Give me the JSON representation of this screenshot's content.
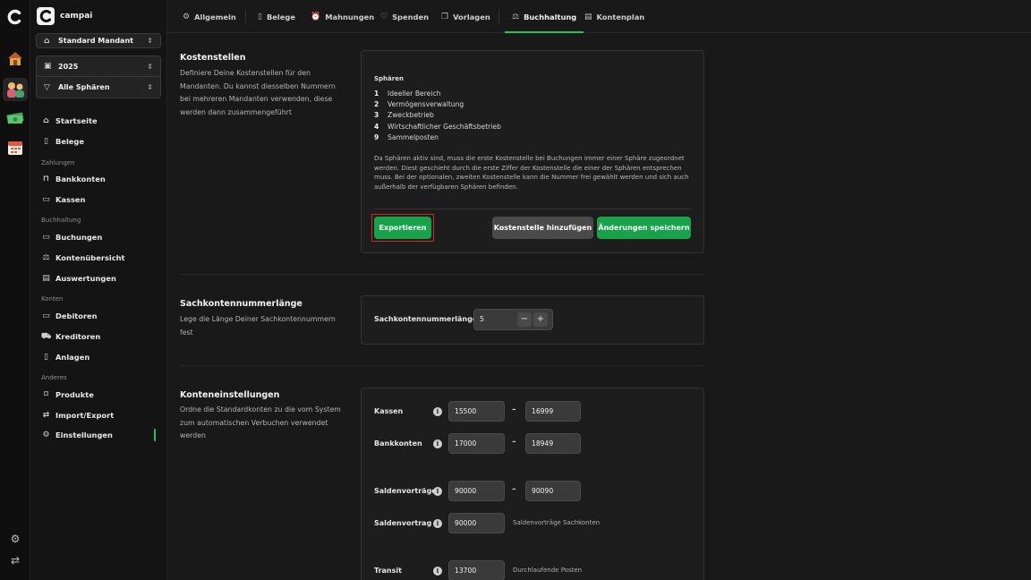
{
  "app": {
    "name": "campai",
    "tenant": "Standard Mandant",
    "year": "2025",
    "sphere_filter": "Alle Sphären"
  },
  "rail": {
    "apps": [
      "house-app-icon",
      "people-app-icon",
      "money-app-icon",
      "calendar-app-icon"
    ],
    "bottom": [
      "settings-cog-icon",
      "switch-arrows-icon"
    ]
  },
  "sidebar": {
    "items": [
      {
        "label": "Startseite",
        "icon": "home-icon"
      },
      {
        "label": "Belege",
        "icon": "document-icon"
      }
    ],
    "sections": [
      {
        "title": "Zahlungen",
        "items": [
          {
            "label": "Bankkonten",
            "icon": "bank-icon"
          },
          {
            "label": "Kassen",
            "icon": "cash-icon"
          }
        ]
      },
      {
        "title": "Buchhaltung",
        "items": [
          {
            "label": "Buchungen",
            "icon": "inbox-icon"
          },
          {
            "label": "Kontenübersicht",
            "icon": "scale-icon"
          },
          {
            "label": "Auswertungen",
            "icon": "table-icon"
          }
        ]
      },
      {
        "title": "Konten",
        "items": [
          {
            "label": "Debitoren",
            "icon": "card-icon"
          },
          {
            "label": "Kreditoren",
            "icon": "truck-icon"
          },
          {
            "label": "Anlagen",
            "icon": "book-icon"
          }
        ]
      },
      {
        "title": "Anderes",
        "items": [
          {
            "label": "Produkte",
            "icon": "bag-icon"
          },
          {
            "label": "Import/Export",
            "icon": "arrows-icon"
          },
          {
            "label": "Einstellungen",
            "icon": "gear-icon",
            "active": true
          }
        ]
      }
    ]
  },
  "tabs": [
    {
      "label": "Allgemein",
      "icon": "gear-icon"
    },
    {
      "label": "Belege",
      "icon": "document-icon"
    },
    {
      "label": "Mahnungen",
      "icon": "alarm-icon"
    },
    {
      "label": "Spenden",
      "icon": "heart-icon"
    },
    {
      "label": "Vorlagen",
      "icon": "copy-icon"
    },
    {
      "label": "Buchhaltung",
      "icon": "scale-icon",
      "active": true
    },
    {
      "label": "Kontenplan",
      "icon": "table-icon"
    }
  ],
  "kostenstellen": {
    "title": "Kostenstellen",
    "description": "Definiere Deine Kostenstellen für den Mandanten. Du kannst diesselben Nummern bei mehreren Mandanten verwenden, diese werden dann zusammengeführt",
    "spheres_title": "Sphären",
    "spheres": [
      {
        "num": "1",
        "label": "Ideeller Bereich"
      },
      {
        "num": "2",
        "label": "Vermögensverwaltung"
      },
      {
        "num": "3",
        "label": "Zweckbetrieb"
      },
      {
        "num": "4",
        "label": "Wirtschaftlicher Geschäftsbetrieb"
      },
      {
        "num": "9",
        "label": "Sammelposten"
      }
    ],
    "note": "Da Sphären aktiv sind, muss die erste Kostenstelle bei Buchungen immer einer Sphäre zugeordnet werden. Diest geschieht durch die erste Ziffer der Kostenstelle die einer der Sphären entsprechen muss. Bei der optionalen, zweiten Kostenstelle kann die Nummer frei gewählt werden und sich auch außerhalb der verfügbaren Sphären befinden.",
    "export_label": "Exportieren",
    "add_label": "Kostenstelle hinzufügen",
    "save_label": "Änderungen speichern"
  },
  "sachkonten": {
    "title": "Sachkontennummerlänge",
    "description": "Lege die Länge Deiner Sachkontennummern fest",
    "field_label": "Sachkontennummerlänge",
    "value": "5",
    "minus": "−",
    "plus": "+"
  },
  "konten": {
    "title": "Konteneinstellungen",
    "description": "Ordne die Standardkonten zu die vom System zum automatischen Verbuchen verwendet werden",
    "rows": [
      {
        "label": "Kassen",
        "from": "15500",
        "to": "16999"
      },
      {
        "label": "Bankkonten",
        "from": "17000",
        "to": "18949"
      },
      {
        "label": "Saldenvorträge",
        "from": "90000",
        "to": "90090"
      },
      {
        "label": "Saldenvortrag",
        "value": "90000",
        "hint": "Saldenvorträge Sachkonten"
      },
      {
        "label": "Transit",
        "value": "13700",
        "hint": "Durchlaufende Posten"
      }
    ],
    "dash": "–"
  },
  "colors": {
    "accent": "#22c55e",
    "primary_button": "#16a34a",
    "focus": "#e02424"
  }
}
